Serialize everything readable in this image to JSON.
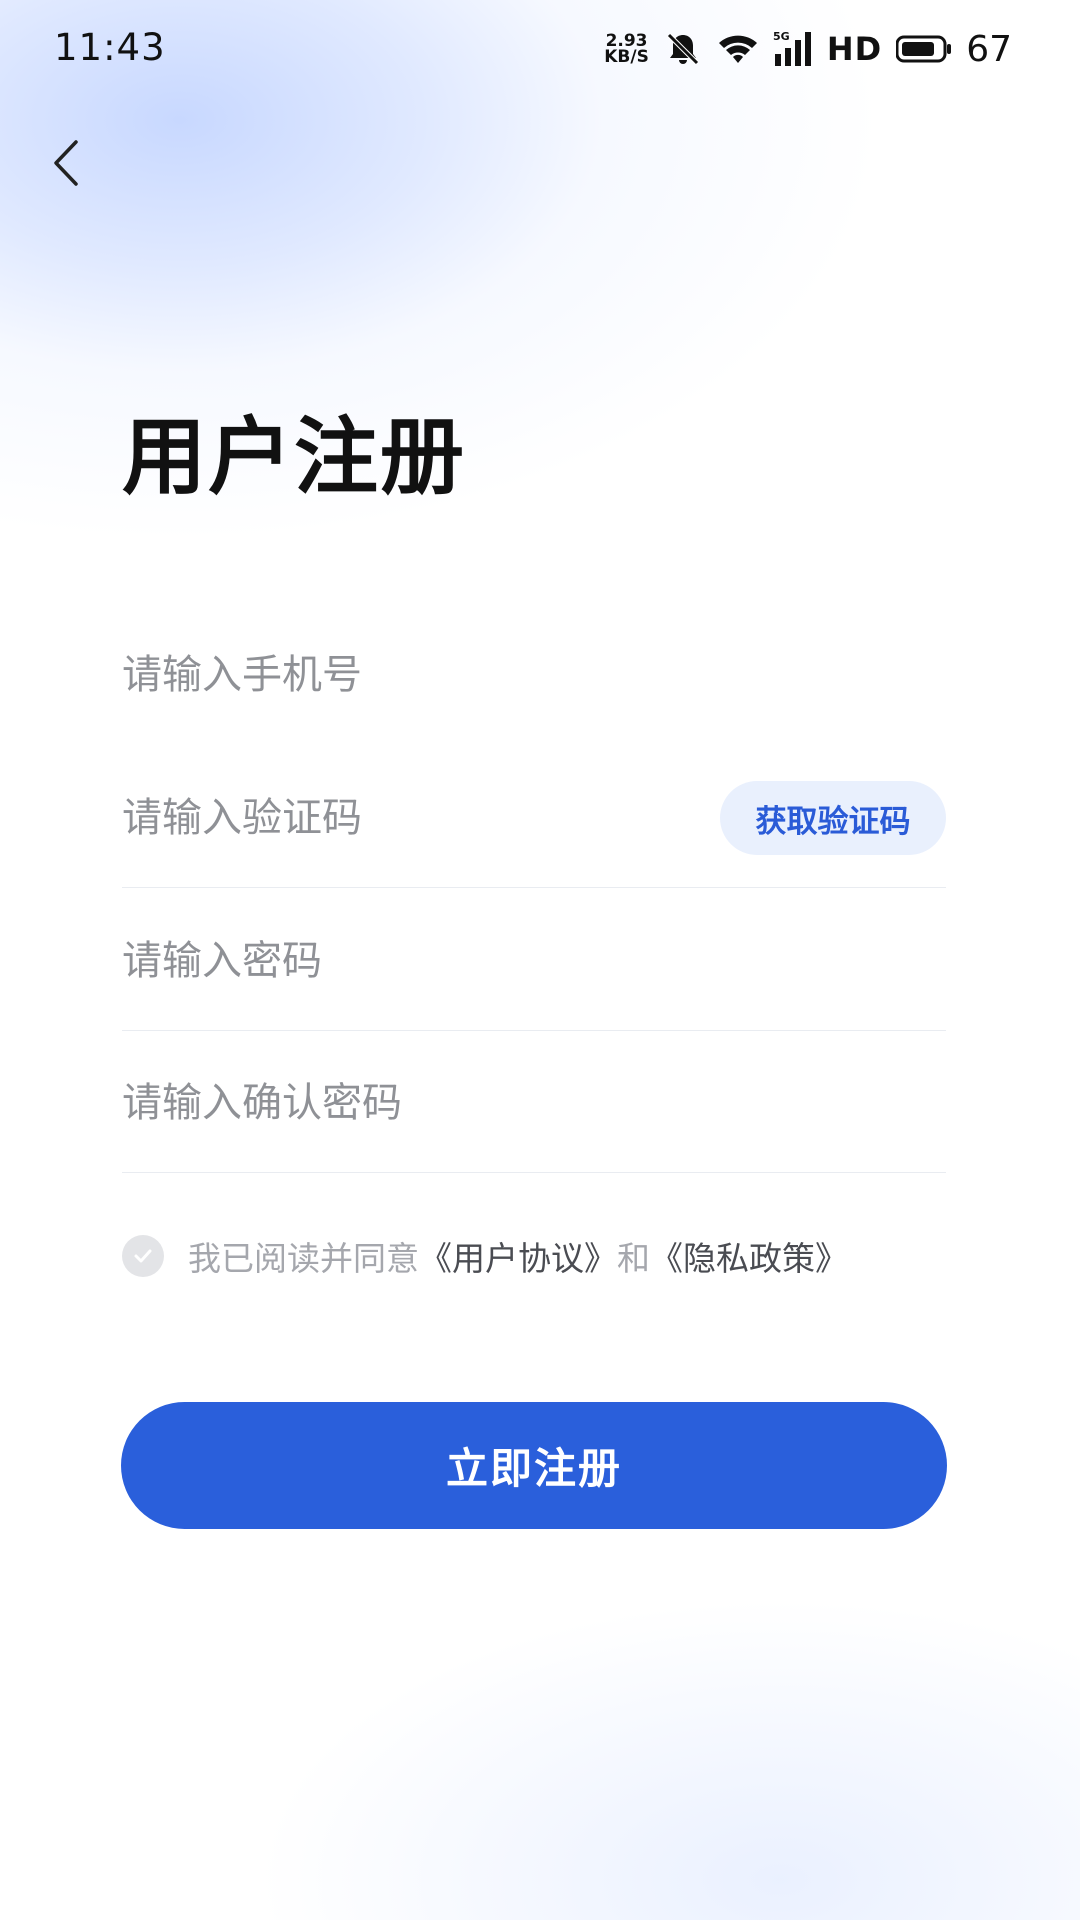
{
  "status_bar": {
    "time": "11:43",
    "net_speed_value": "2.93",
    "net_speed_unit": "KB/S",
    "network_type": "5G",
    "hd_label": "HD",
    "battery_level": "67",
    "icons": [
      "mute-bell-icon",
      "wifi-icon",
      "signal-icon",
      "battery-icon"
    ]
  },
  "nav": {
    "back_icon": "chevron-left-icon"
  },
  "page": {
    "title": "用户注册"
  },
  "form": {
    "phone_placeholder": "请输入手机号",
    "code_placeholder": "请输入验证码",
    "get_code_label": "获取验证码",
    "password_placeholder": "请输入密码",
    "confirm_password_placeholder": "请输入确认密码"
  },
  "agreement": {
    "prefix": "我已阅读并同意",
    "user_agreement": "《用户协议》",
    "conjunction": "和",
    "privacy_policy": "《隐私政策》",
    "checked": false
  },
  "submit": {
    "label": "立即注册"
  },
  "colors": {
    "primary": "#2a5fdb",
    "code_button_bg": "#e9f0fd",
    "code_button_text": "#2a5bd7",
    "placeholder": "#8f9196"
  }
}
